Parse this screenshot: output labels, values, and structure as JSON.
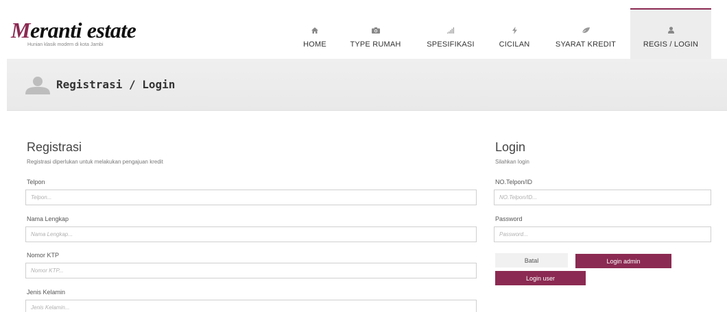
{
  "brand": {
    "title_initial": "M",
    "title_rest": "eranti estate",
    "tagline": "Hunian klasik modern di kota Jambi",
    "accent_color": "#8b2a52"
  },
  "nav": {
    "items": [
      {
        "label": "HOME",
        "icon": "home-icon"
      },
      {
        "label": "TYPE RUMAH",
        "icon": "camera-icon"
      },
      {
        "label": "SPESIFIKASI",
        "icon": "signal-icon"
      },
      {
        "label": "CICILAN",
        "icon": "bolt-icon"
      },
      {
        "label": "SYARAT KREDIT",
        "icon": "leaf-icon"
      },
      {
        "label": "REGIS / LOGIN",
        "icon": "user-icon",
        "active": true
      }
    ]
  },
  "banner": {
    "title": "Registrasi / Login",
    "icon": "user-avatar-icon"
  },
  "registration": {
    "title": "Registrasi",
    "subtitle": "Registrasi diperlukan untuk melakukan pengajuan kredit",
    "fields": [
      {
        "label": "Telpon",
        "placeholder": "Telpon...",
        "value": ""
      },
      {
        "label": "Nama Lengkap",
        "placeholder": "Nama Lengkap...",
        "value": ""
      },
      {
        "label": "Nomor KTP",
        "placeholder": "Nomor KTP...",
        "value": ""
      },
      {
        "label": "Jenis Kelamin",
        "placeholder": "Jenis Kelamin...",
        "value": ""
      }
    ]
  },
  "login": {
    "title": "Login",
    "subtitle": "Silahkan login",
    "fields": [
      {
        "label": "NO.Telpon/ID",
        "placeholder": "NO.Telpon/ID...",
        "value": ""
      },
      {
        "label": "Password",
        "placeholder": "Password...",
        "value": ""
      }
    ],
    "buttons": {
      "cancel": "Batal",
      "login_admin": "Login admin",
      "login_user": "Login user"
    }
  }
}
